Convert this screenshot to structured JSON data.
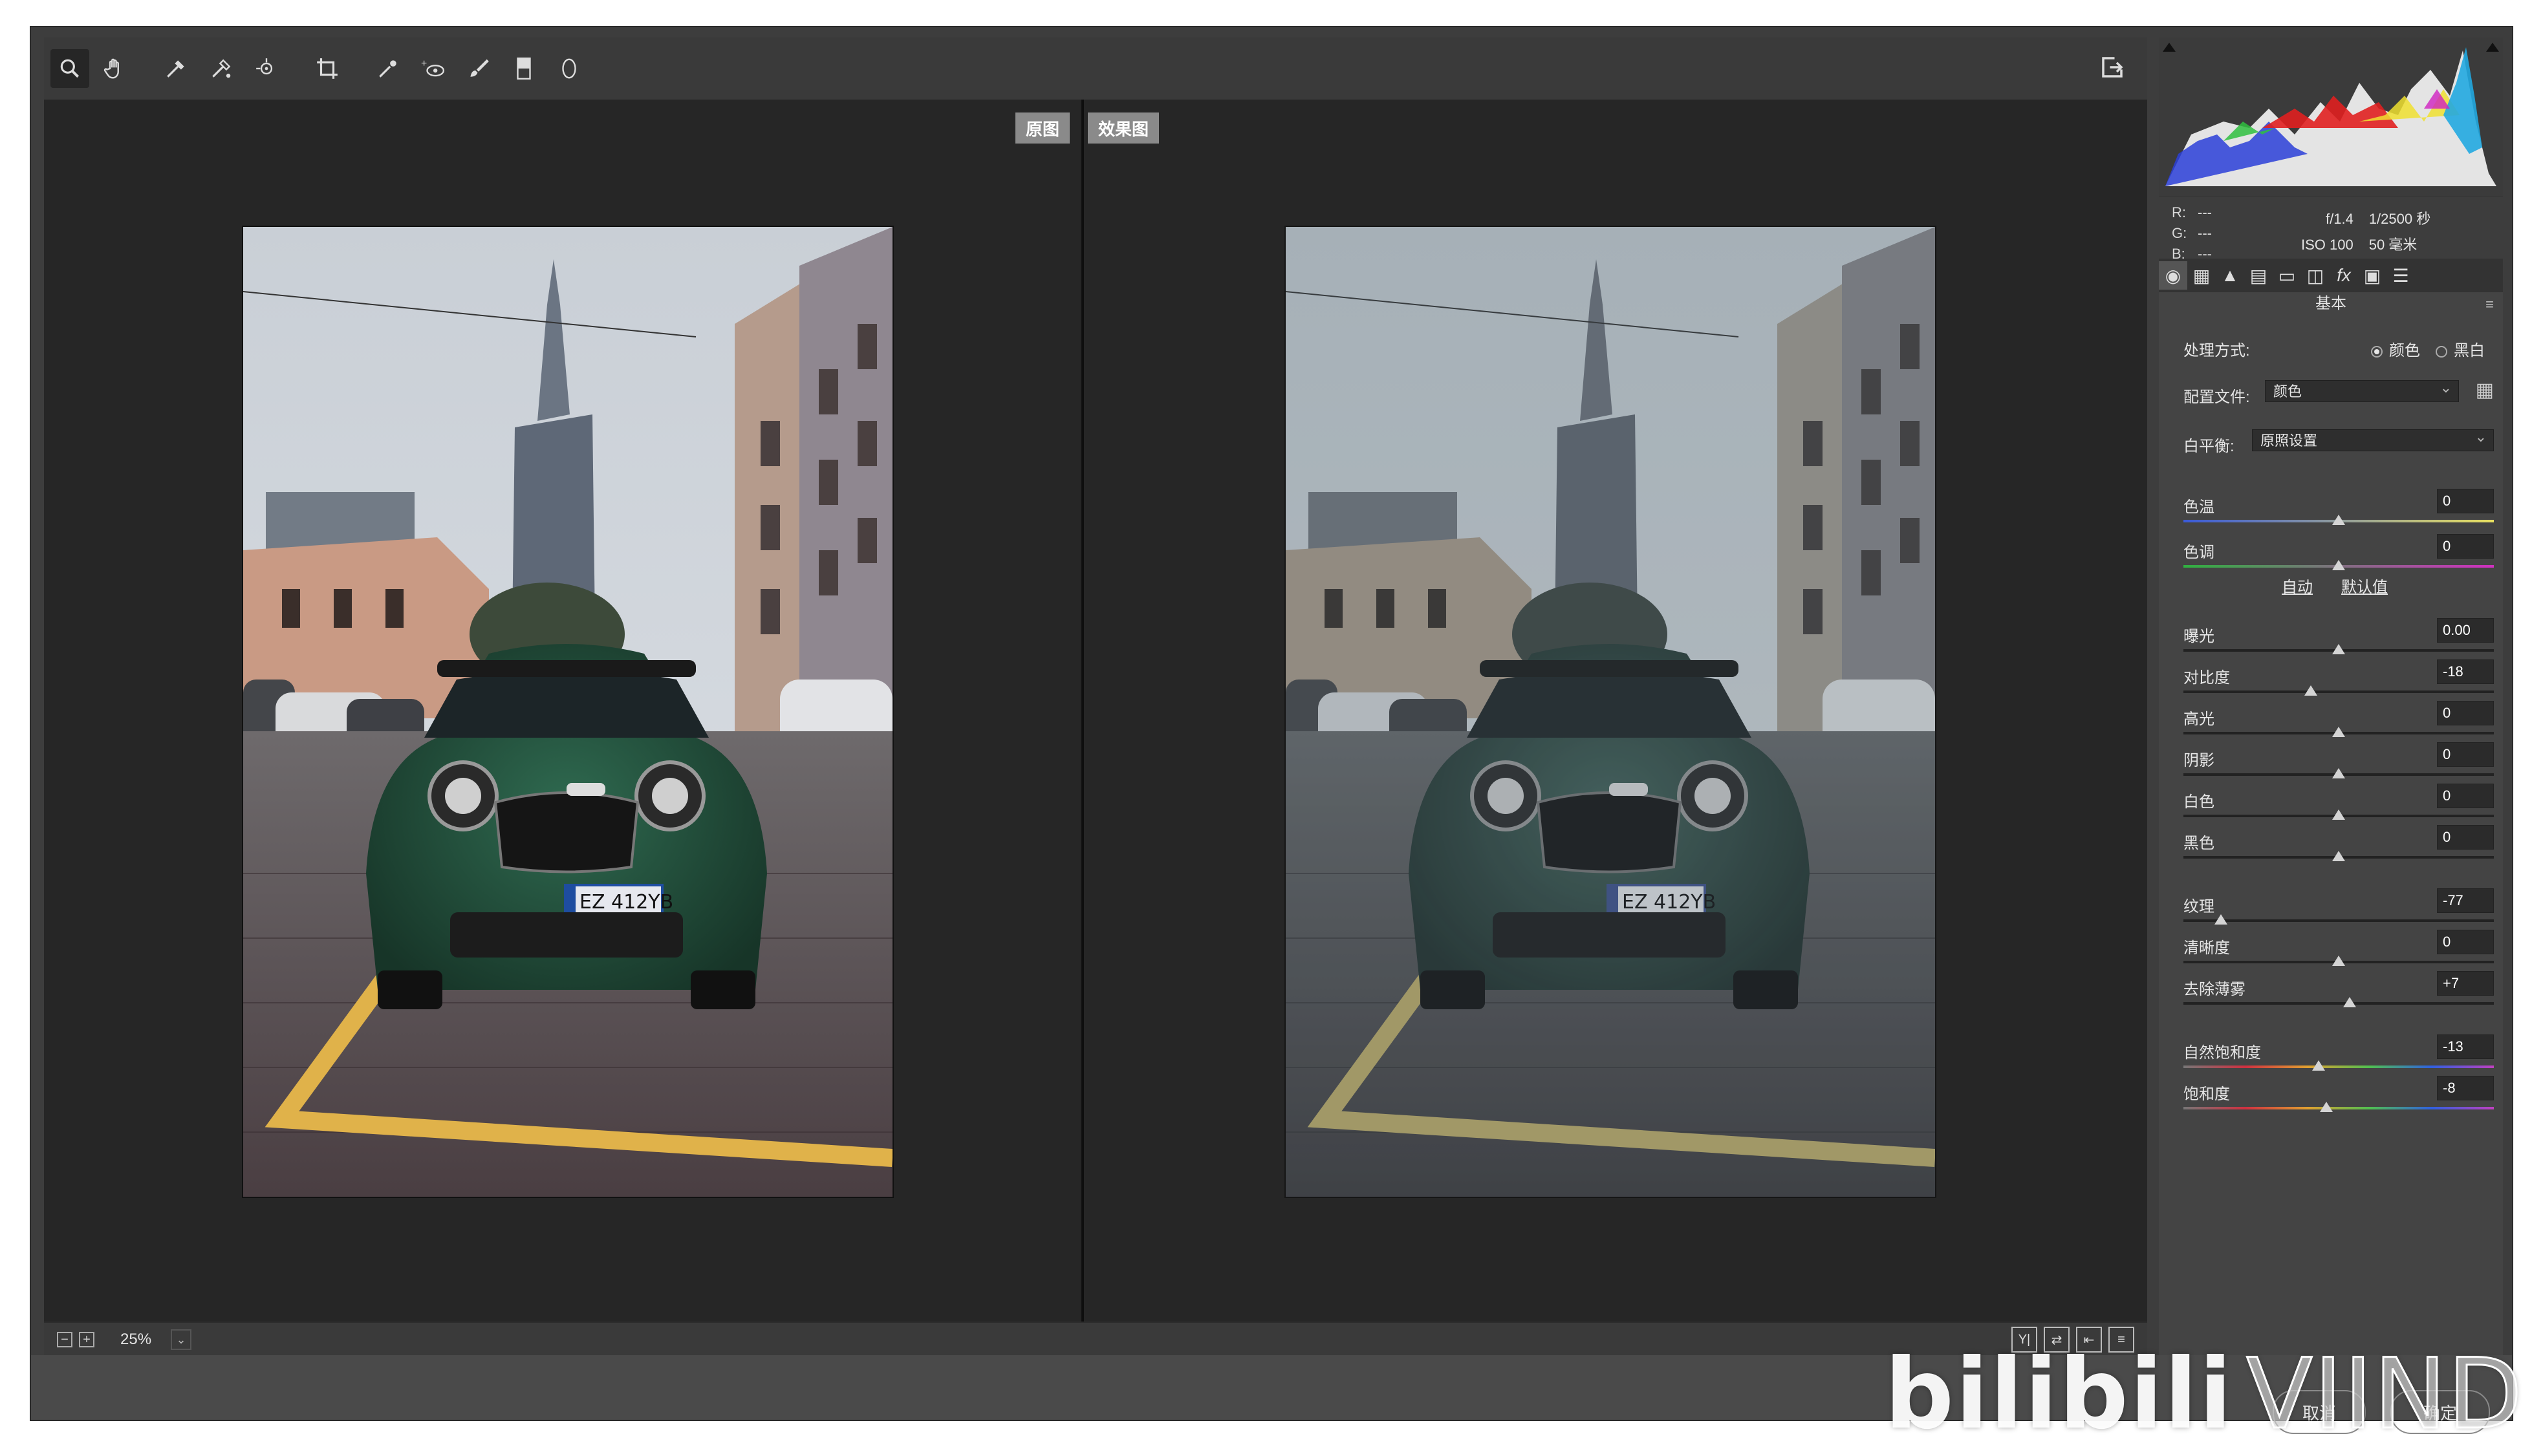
{
  "view_labels": {
    "before": "原图",
    "after": "效果图"
  },
  "toolbar": {
    "tools": [
      "zoom-icon",
      "hand-icon",
      "white-balance-icon",
      "color-sampler-icon",
      "target-adjust-icon",
      "crop-icon",
      "spot-removal-icon",
      "red-eye-icon",
      "adjustment-brush-icon",
      "graduated-filter-icon",
      "radial-filter-icon"
    ]
  },
  "photo": {
    "plate": "EZ 412YB"
  },
  "status": {
    "zoom": "25%",
    "zoom_minus": "−",
    "zoom_plus": "+"
  },
  "readouts": {
    "r_label": "R:",
    "r_val": "---",
    "g_label": "G:",
    "g_val": "---",
    "b_label": "B:",
    "b_val": "---",
    "aperture": "f/1.4",
    "shutter": "1/2500 秒",
    "iso": "ISO 100",
    "focal": "50 毫米"
  },
  "panel": {
    "section_title": "基本",
    "treatment_label": "处理方式:",
    "treatment_color": "颜色",
    "treatment_bw": "黑白",
    "profile_label": "配置文件:",
    "profile_value": "颜色",
    "wb_label": "白平衡:",
    "wb_value": "原照设置",
    "auto": "自动",
    "default": "默认值",
    "sliders": [
      {
        "label": "色温",
        "value": "0"
      },
      {
        "label": "色调",
        "value": "0"
      },
      {
        "label": "曝光",
        "value": "0.00"
      },
      {
        "label": "对比度",
        "value": "-18"
      },
      {
        "label": "高光",
        "value": "0"
      },
      {
        "label": "阴影",
        "value": "0"
      },
      {
        "label": "白色",
        "value": "0"
      },
      {
        "label": "黑色",
        "value": "0"
      },
      {
        "label": "纹理",
        "value": "-77"
      },
      {
        "label": "清晰度",
        "value": "0"
      },
      {
        "label": "去除薄雾",
        "value": "+7"
      },
      {
        "label": "自然饱和度",
        "value": "-13"
      },
      {
        "label": "饱和度",
        "value": "-8"
      }
    ]
  },
  "dialog": {
    "cancel": "取消",
    "ok": "确定"
  },
  "watermark": {
    "brand": "bilibili",
    "suffix": "VIIND"
  }
}
